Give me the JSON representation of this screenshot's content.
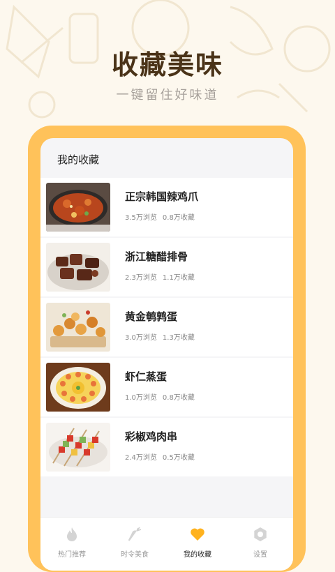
{
  "header": {
    "title": "收藏美味",
    "subtitle": "一键留住好味道"
  },
  "screen": {
    "title": "我的收藏"
  },
  "favorites": [
    {
      "name": "正宗韩国辣鸡爪",
      "views": "3.5万浏览",
      "saves": "0.8万收藏"
    },
    {
      "name": "浙江糖醋排骨",
      "views": "2.3万浏览",
      "saves": "1.1万收藏"
    },
    {
      "name": "黄金鹌鹑蛋",
      "views": "3.0万浏览",
      "saves": "1.3万收藏"
    },
    {
      "name": "虾仁蒸蛋",
      "views": "1.0万浏览",
      "saves": "0.8万收藏"
    },
    {
      "name": "彩椒鸡肉串",
      "views": "2.4万浏览",
      "saves": "0.5万收藏"
    }
  ],
  "tabs": [
    {
      "label": "热门推荐",
      "icon": "flame-icon"
    },
    {
      "label": "时令美食",
      "icon": "carrot-icon"
    },
    {
      "label": "我的收藏",
      "icon": "heart-icon"
    },
    {
      "label": "设置",
      "icon": "gear-icon"
    }
  ],
  "colors": {
    "accent": "#ffc25a",
    "active_icon": "#ffb21e",
    "title": "#4a3318"
  }
}
